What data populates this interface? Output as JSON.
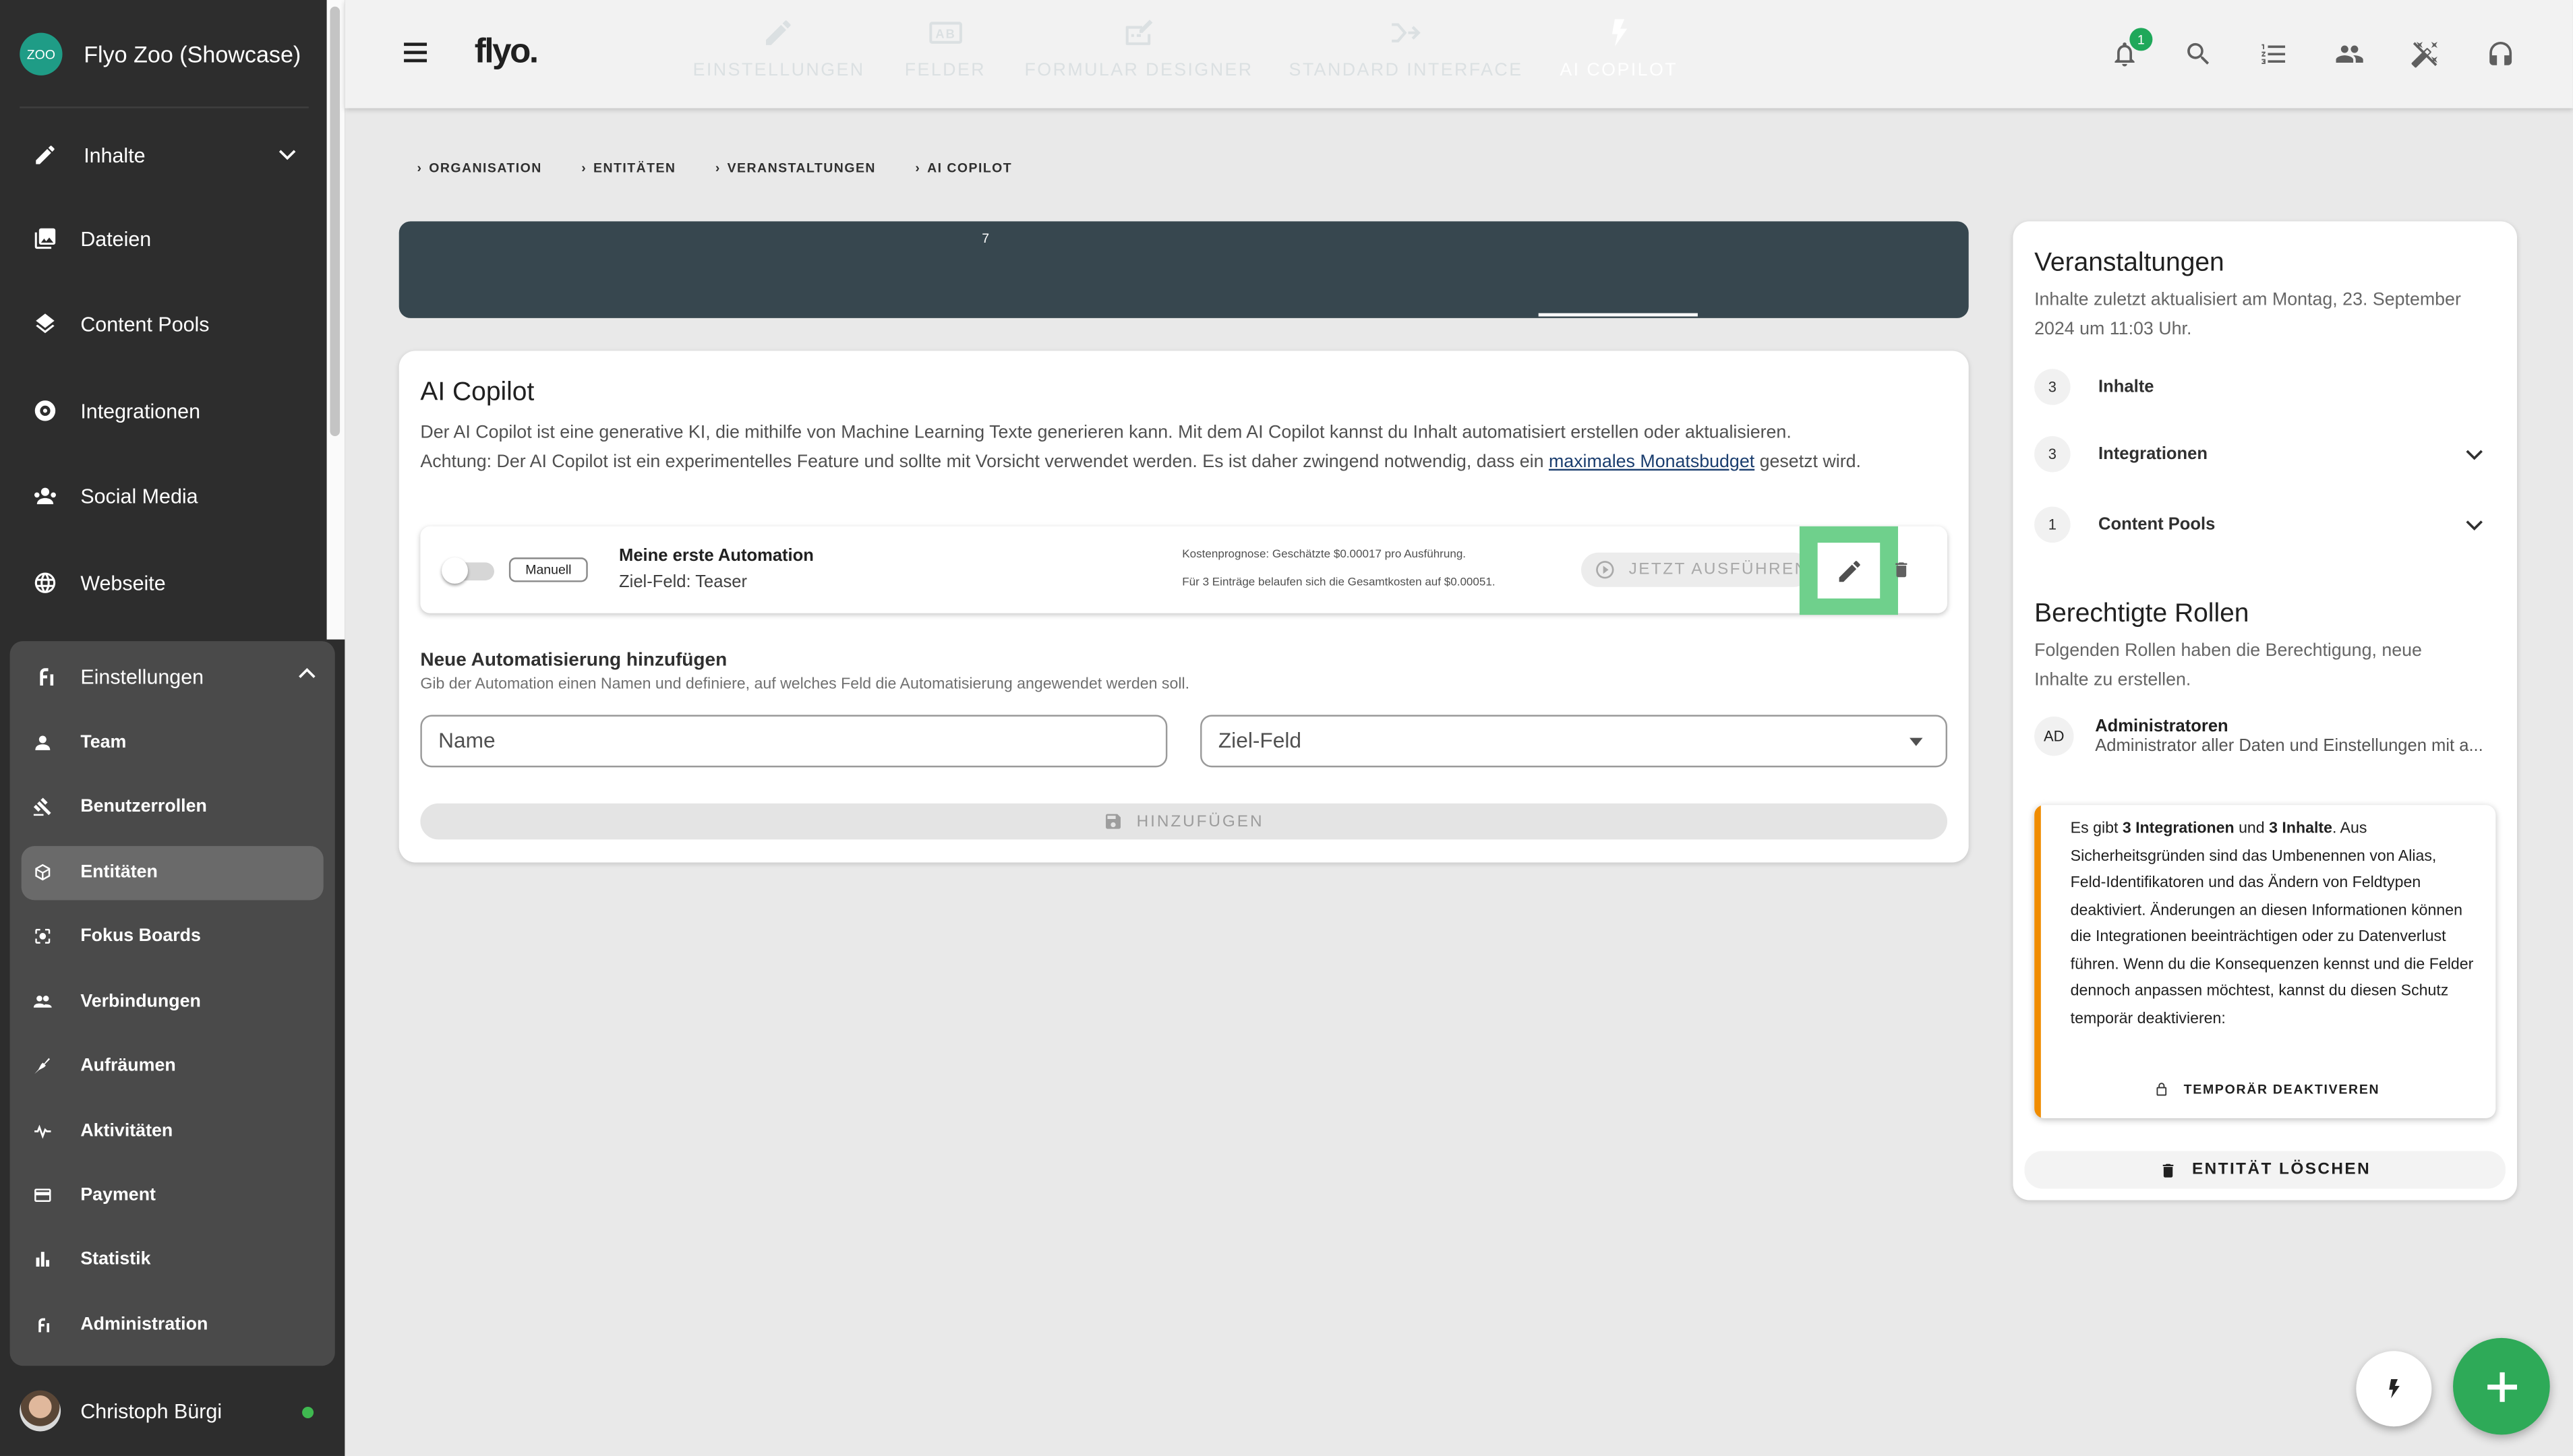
{
  "workspace": {
    "logo_text": "ZOO",
    "name": "Flyo Zoo (Showcase)"
  },
  "sidebar": {
    "items": [
      {
        "label": "Inhalte"
      },
      {
        "label": "Dateien"
      },
      {
        "label": "Content Pools"
      },
      {
        "label": "Integrationen"
      },
      {
        "label": "Social Media"
      },
      {
        "label": "Webseite"
      }
    ],
    "settings_label": "Einstellungen",
    "settings_items": [
      {
        "label": "Team"
      },
      {
        "label": "Benutzerrollen"
      },
      {
        "label": "Entitäten"
      },
      {
        "label": "Fokus Boards"
      },
      {
        "label": "Verbindungen"
      },
      {
        "label": "Aufräumen"
      },
      {
        "label": "Aktivitäten"
      },
      {
        "label": "Payment"
      },
      {
        "label": "Statistik"
      },
      {
        "label": "Administration"
      }
    ],
    "active_item": "Entitäten",
    "user_name": "Christoph Bürgi"
  },
  "topbar": {
    "logo": "flyo.",
    "notification_count": "1"
  },
  "breadcrumb": [
    "ORGANISATION",
    "ENTITÄTEN",
    "VERANSTALTUNGEN",
    "AI COPILOT"
  ],
  "tabs": [
    {
      "label": "EINSTELLUNGEN",
      "icon": "pencil-icon"
    },
    {
      "label": "FELDER",
      "icon": "ab-field-icon",
      "count": "7"
    },
    {
      "label": "FORMULAR DESIGNER",
      "icon": "form-edit-icon"
    },
    {
      "label": "STANDARD INTERFACE",
      "icon": "merge-arrow-icon"
    },
    {
      "label": "AI COPILOT",
      "icon": "bolt-icon",
      "active": true
    }
  ],
  "copilot": {
    "title": "AI Copilot",
    "desc_line1": "Der AI Copilot ist eine generative KI, die mithilfe von Machine Learning Texte generieren kann. Mit dem AI Copilot kannst du Inhalt automatisiert erstellen oder aktualisieren.",
    "desc_line2_pre": "Achtung: Der AI Copilot ist ein experimentelles Feature und sollte mit Vorsicht verwendet werden. Es ist daher zwingend notwendig, dass ein ",
    "desc_link": "maximales Monatsbudget",
    "desc_line2_post": " gesetzt wird.",
    "automation": {
      "mode_chip": "Manuell",
      "name": "Meine erste Automation",
      "field": "Ziel-Feld: Teaser",
      "cost_estimate": "Kostenprognose: Geschätzte $0.00017 pro Ausführung.",
      "cost_total": "Für 3 Einträge belaufen sich die Gesamtkosten auf $0.00051.",
      "run_label": "JETZT AUSFÜHREN"
    },
    "add_title": "Neue Automatisierung hinzufügen",
    "add_subtitle": "Gib der Automation einen Namen und definiere, auf welches Feld die Automatisierung angewendet werden soll.",
    "name_placeholder": "Name",
    "target_placeholder": "Ziel-Feld",
    "add_button": "HINZUFÜGEN"
  },
  "right_panel": {
    "title": "Veranstaltungen",
    "subtitle": "Inhalte zuletzt aktualisiert am Montag, 23. September 2024 um 11:03 Uhr.",
    "counts": [
      {
        "num": "3",
        "label": "Inhalte"
      },
      {
        "num": "3",
        "label": "Integrationen"
      },
      {
        "num": "1",
        "label": "Content Pools"
      }
    ],
    "roles_title": "Berechtigte Rollen",
    "roles_subtitle": "Folgenden Rollen haben die Berechtigung, neue Inhalte zu erstellen.",
    "role": {
      "initials": "AD",
      "name": "Administratoren",
      "description": "Administrator aller Daten und Einstellungen mit a..."
    },
    "warning": {
      "pre": "Es gibt ",
      "integrations": "3 Integrationen",
      "and": " und ",
      "contents": "3 Inhalte",
      "post": ". Aus Sicherheitsgründen sind das Umbenennen von Alias, Feld-Identifikatoren und das Ändern von Feldtypen deaktiviert. Änderungen an diesen Informationen können die Integrationen beeinträchtigen oder zu Datenverlust führen. Wenn du die Konsequenzen kennst und die Felder dennoch anpassen möchtest, kannst du diesen Schutz temporär deaktivieren:",
      "button": "TEMPORÄR DEAKTIVEREN"
    },
    "delete_button": "ENTITÄT LÖSCHEN"
  },
  "colors": {
    "accent_green": "#2eaa58",
    "tab_bar": "#37474f",
    "warning_orange": "#f08c00",
    "highlight": "#6fd08c"
  }
}
